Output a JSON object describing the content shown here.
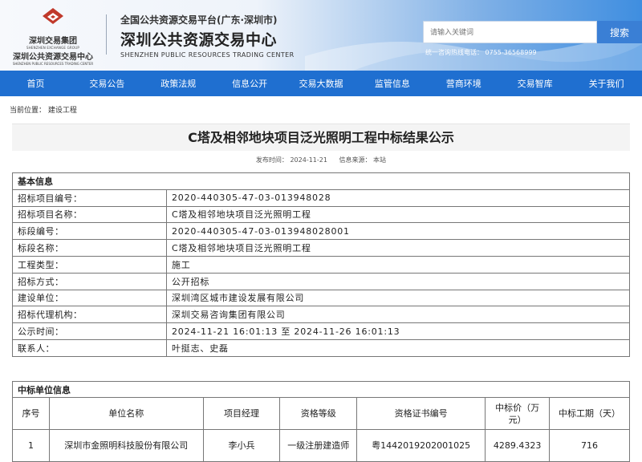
{
  "logo": {
    "cn": "深圳交易集团",
    "en": "SHENZHEN EXCHANGE GROUP",
    "cn2": "深圳公共资源交易中心",
    "en2": "SHENZHEN PUBLIC RESOURCES TRADING CENTER"
  },
  "header": {
    "subtitle": "全国公共资源交易平台(广东·深圳市)",
    "title": "深圳公共资源交易中心",
    "title_en": "SHENZHEN PUBLIC RESOURCES TRADING CENTER",
    "search_placeholder": "请输入关键词",
    "search_button": "搜索",
    "hotline": "统一咨询热线电话： 0755-36568999"
  },
  "nav": [
    "首页",
    "交易公告",
    "政策法规",
    "信息公开",
    "交易大数据",
    "监管信息",
    "营商环境",
    "交易智库",
    "关于我们"
  ],
  "breadcrumb": "当前位置： 建设工程",
  "article": {
    "title": "C塔及相邻地块项目泛光照明工程中标结果公示",
    "publish_time": "发布时间： 2024-11-21",
    "source": "信息来源： 本站"
  },
  "basic_info": {
    "heading": "基本信息",
    "rows": [
      {
        "label": "招标项目编号：",
        "value": "2020-440305-47-03-013948028"
      },
      {
        "label": "招标项目名称：",
        "value": "C塔及相邻地块项目泛光照明工程"
      },
      {
        "label": "标段编号：",
        "value": "2020-440305-47-03-013948028001"
      },
      {
        "label": "标段名称：",
        "value": "C塔及相邻地块项目泛光照明工程"
      },
      {
        "label": "工程类型：",
        "value": "施工"
      },
      {
        "label": "招标方式：",
        "value": "公开招标"
      },
      {
        "label": "建设单位：",
        "value": "深圳湾区城市建设发展有限公司"
      },
      {
        "label": "招标代理机构：",
        "value": "深圳交易咨询集团有限公司"
      },
      {
        "label": "公示时间：",
        "value": "2024-11-21 16:01:13 至 2024-11-26 16:01:13"
      },
      {
        "label": "联系人：",
        "value": "叶挺志、史磊"
      }
    ]
  },
  "winner": {
    "heading": "中标单位信息",
    "columns": [
      "序号",
      "单位名称",
      "项目经理",
      "资格等级",
      "资格证书编号",
      "中标价（万元）",
      "中标工期（天）"
    ],
    "row": [
      "1",
      "深圳市金照明科技股份有限公司",
      "李小兵",
      "一级注册建造师",
      "粤1442019202001025",
      "4289.4323",
      "716"
    ]
  }
}
